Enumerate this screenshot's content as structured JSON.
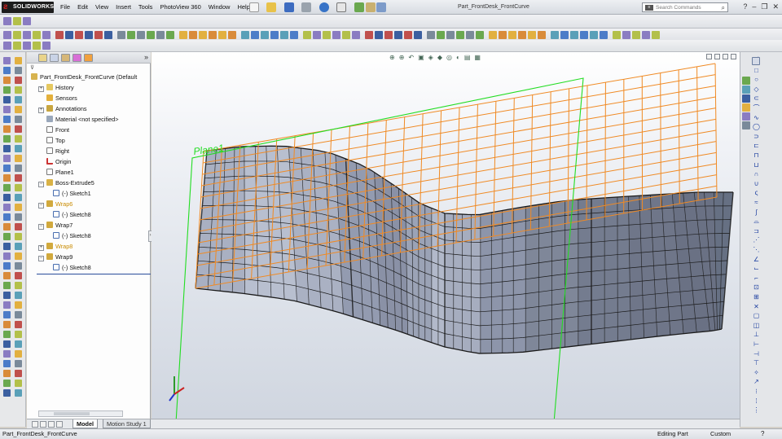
{
  "app": {
    "logo_text": "SOLIDWORKS",
    "document_title": "Part_FrontDesk_FrontCurve"
  },
  "menu": [
    "File",
    "Edit",
    "View",
    "Insert",
    "Tools",
    "PhotoView 360",
    "Window",
    "Help"
  ],
  "search": {
    "placeholder": "Search Commands"
  },
  "feature_tree": {
    "root": "Part_FrontDesk_FrontCurve  (Default",
    "items": [
      {
        "label": "History",
        "icon": "history-folder-icon"
      },
      {
        "label": "Sensors",
        "icon": "sensors-icon"
      },
      {
        "label": "Annotations",
        "icon": "annotations-icon"
      },
      {
        "label": "Material <not specified>",
        "icon": "material-icon"
      },
      {
        "label": "Front",
        "icon": "plane-icon"
      },
      {
        "label": "Top",
        "icon": "plane-icon"
      },
      {
        "label": "Right",
        "icon": "plane-icon"
      },
      {
        "label": "Origin",
        "icon": "origin-icon"
      },
      {
        "label": "Plane1",
        "icon": "plane-icon"
      },
      {
        "label": "Boss-Extrude5",
        "icon": "extrude-icon"
      },
      {
        "label": "(-) Sketch1",
        "icon": "sketch-icon"
      },
      {
        "label": "Wrap6",
        "icon": "wrap-warning-icon"
      },
      {
        "label": "(-) Sketch8",
        "icon": "sketch-icon"
      },
      {
        "label": "Wrap7",
        "icon": "wrap-icon"
      },
      {
        "label": "(-) Sketch8",
        "icon": "sketch-icon"
      },
      {
        "label": "Wrap8",
        "icon": "wrap-warning-icon"
      },
      {
        "label": "Wrap9",
        "icon": "wrap-icon"
      },
      {
        "label": "(-) Sketch8",
        "icon": "sketch-icon"
      }
    ]
  },
  "viewport": {
    "plane_label": "Plane1",
    "colors": {
      "plane": "#22dd22",
      "sketch_grid": "#f08a24",
      "surface": "#9ea7b8",
      "surface_edge": "#1a1a1a"
    }
  },
  "bottom_tabs": {
    "model": "Model",
    "motion": "Motion Study 1"
  },
  "status": {
    "doc_name": "Part_FrontDesk_FrontCurve",
    "mode": "Editing Part",
    "units": "Custom"
  }
}
